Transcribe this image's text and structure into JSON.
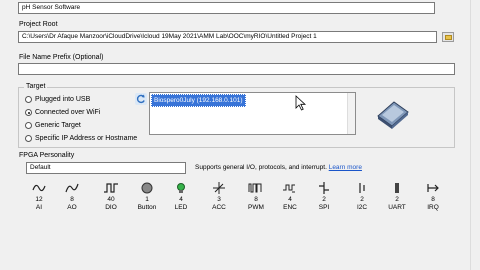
{
  "project_name": {
    "value": "pH Sensor Software"
  },
  "project_root": {
    "label": "Project Root",
    "value": "C:\\Users\\Dr Afaque Manzoor\\iCloudDrive\\Icloud 19May 2021\\AMM Lab\\OOC\\myRIO\\Untitled Project 1"
  },
  "file_prefix": {
    "label": "File Name Prefix (Optional)",
    "value": ""
  },
  "target": {
    "label": "Target",
    "options": [
      {
        "label": "Plugged into USB",
        "selected": false
      },
      {
        "label": "Connected over WiFi",
        "selected": true
      },
      {
        "label": "Generic Target",
        "selected": false
      },
      {
        "label": "Specific IP Address or Hostname",
        "selected": false
      }
    ],
    "devices": [
      "Biospero0July (192.168.0.101)"
    ],
    "selected_device": "Biospero0July (192.168.0.101)"
  },
  "fpga": {
    "label": "FPGA Personality",
    "selected": "Default",
    "description": "Supports general I/O, protocols, and interrupt.",
    "learn_more": "Learn more",
    "items": [
      {
        "count": "12",
        "name": "AI",
        "icon": "analog-input-icon"
      },
      {
        "count": "8",
        "name": "AO",
        "icon": "analog-output-icon"
      },
      {
        "count": "40",
        "name": "DIO",
        "icon": "digital-io-icon"
      },
      {
        "count": "1",
        "name": "Button",
        "icon": "button-icon"
      },
      {
        "count": "4",
        "name": "LED",
        "icon": "led-icon"
      },
      {
        "count": "3",
        "name": "ACC",
        "icon": "accelerometer-icon"
      },
      {
        "count": "8",
        "name": "PWM",
        "icon": "pwm-icon"
      },
      {
        "count": "4",
        "name": "ENC",
        "icon": "encoder-icon"
      },
      {
        "count": "2",
        "name": "SPI",
        "icon": "spi-icon"
      },
      {
        "count": "2",
        "name": "I2C",
        "icon": "i2c-icon"
      },
      {
        "count": "2",
        "name": "UART",
        "icon": "uart-icon"
      },
      {
        "count": "8",
        "name": "IRQ",
        "icon": "irq-icon"
      }
    ]
  }
}
